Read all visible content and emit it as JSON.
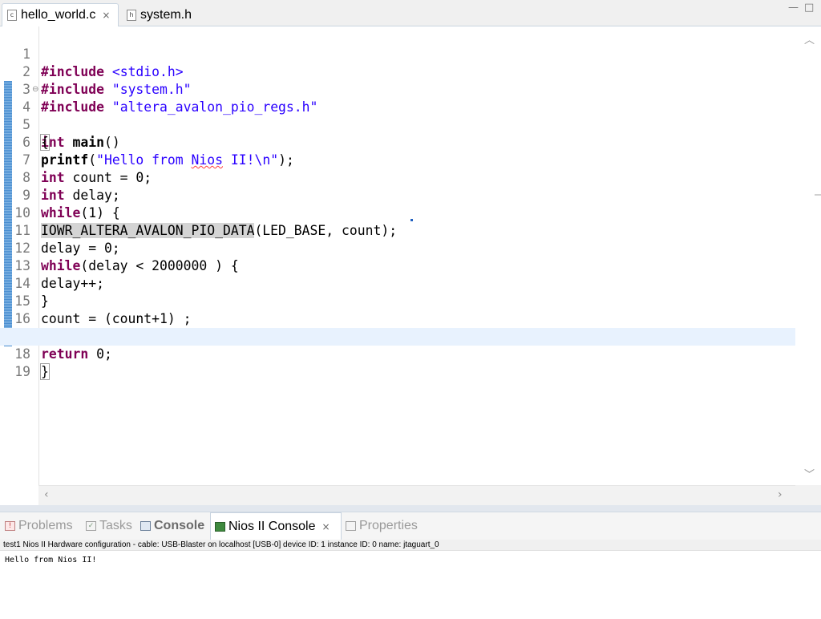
{
  "editor_tabs": [
    {
      "label": "hello_world.c",
      "icon": "c-file-icon",
      "active": true,
      "close": "×"
    },
    {
      "label": "system.h",
      "icon": "h-file-icon",
      "active": false
    }
  ],
  "window_controls": {
    "minimize": "▭",
    "maximize": "▭"
  },
  "code_lines": [
    {
      "n": "1",
      "text": "#include <stdio.h>"
    },
    {
      "n": "2",
      "text": "#include \"system.h\""
    },
    {
      "n": "3",
      "text": "#include \"altera_avalon_pio_regs.h\""
    },
    {
      "n": "4",
      "text": "int main()"
    },
    {
      "n": "5",
      "text": "{"
    },
    {
      "n": "6",
      "text": "printf(\"Hello from Nios II!\\n\");"
    },
    {
      "n": "7",
      "text": "int count = 0;"
    },
    {
      "n": "8",
      "text": "int delay;"
    },
    {
      "n": "9",
      "text": "while(1) {"
    },
    {
      "n": "10",
      "text": "IOWR_ALTERA_AVALON_PIO_DATA(LED_BASE, count);"
    },
    {
      "n": "11",
      "text": "delay = 0;"
    },
    {
      "n": "12",
      "text": "while(delay < 2000000 ) {"
    },
    {
      "n": "13",
      "text": "delay++;"
    },
    {
      "n": "14",
      "text": "}"
    },
    {
      "n": "15",
      "text": "count = (count+1) ;"
    },
    {
      "n": "16",
      "text": "}"
    },
    {
      "n": "17",
      "text": "return 0;"
    },
    {
      "n": "18",
      "text": "}"
    },
    {
      "n": "19",
      "text": ""
    }
  ],
  "fold_marker": "⊖",
  "scroll_icons": {
    "up": "︿",
    "down": "﹀",
    "left": "‹",
    "right": "›"
  },
  "bottom_tabs": [
    {
      "label": "Problems",
      "icon": "problems-icon"
    },
    {
      "label": "Tasks",
      "icon": "tasks-icon"
    },
    {
      "label": "Console",
      "icon": "console-icon"
    },
    {
      "label": "Nios II Console",
      "icon": "nios-console-icon",
      "close": "×",
      "active": true
    },
    {
      "label": "Properties",
      "icon": "properties-icon"
    }
  ],
  "console_status": "test1 Nios II Hardware configuration - cable: USB-Blaster on localhost [USB-0] device ID: 1 instance ID: 0 name: jtaguart_0",
  "console_output": "Hello from Nios II!",
  "colors": {
    "keyword": "#7f0055",
    "string": "#2a00ff",
    "current_line": "#e8f2fe",
    "highlight": "#d4d4d4"
  }
}
